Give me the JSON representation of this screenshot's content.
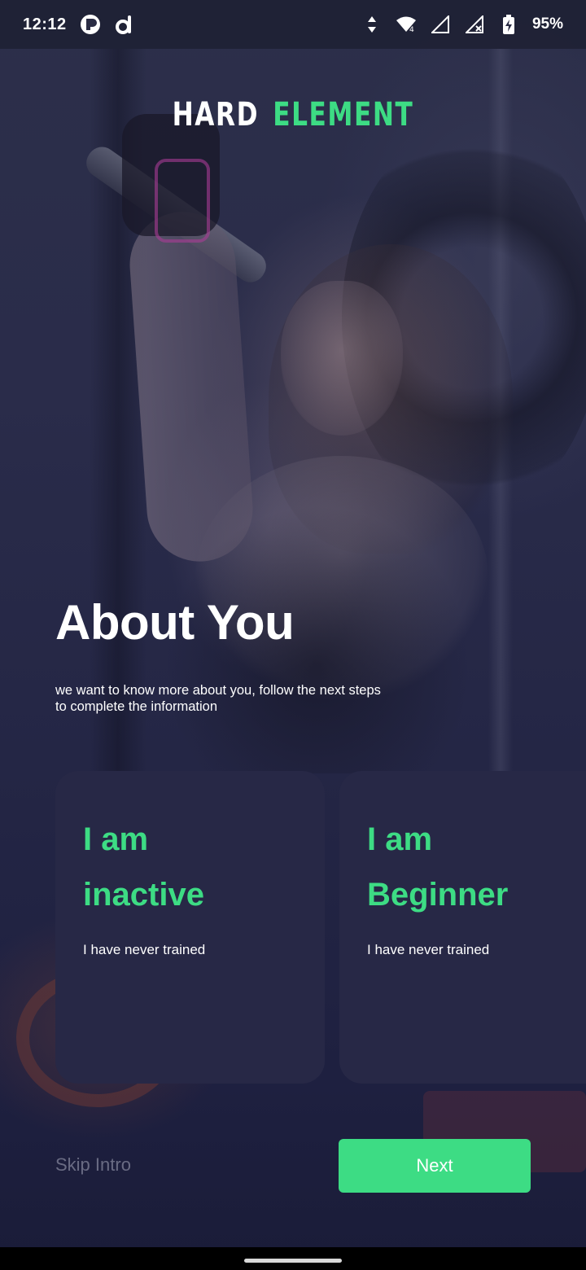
{
  "status_bar": {
    "time": "12:12",
    "battery": "95%",
    "icons": [
      "notification-app-r-icon",
      "notification-app-d-icon",
      "data-arrows-icon",
      "wifi-icon",
      "signal-icon",
      "signal-no-service-icon",
      "battery-charging-icon"
    ]
  },
  "brand": {
    "word1": "HARD",
    "word2": "ELEMENT",
    "accent_color": "#3ddc84"
  },
  "intro": {
    "title": "About You",
    "subtitle": "we want to know more about you, follow the next steps\n to complete the information"
  },
  "cards": [
    {
      "line1": "I am",
      "line2": "inactive",
      "description": "I have never trained"
    },
    {
      "line1": "I am",
      "line2": "Beginner",
      "description": "I have never trained"
    }
  ],
  "actions": {
    "skip_label": "Skip Intro",
    "next_label": "Next"
  },
  "colors": {
    "card_bg": "#272846",
    "overlay": "#1e2040",
    "button": "#3ddc84"
  }
}
